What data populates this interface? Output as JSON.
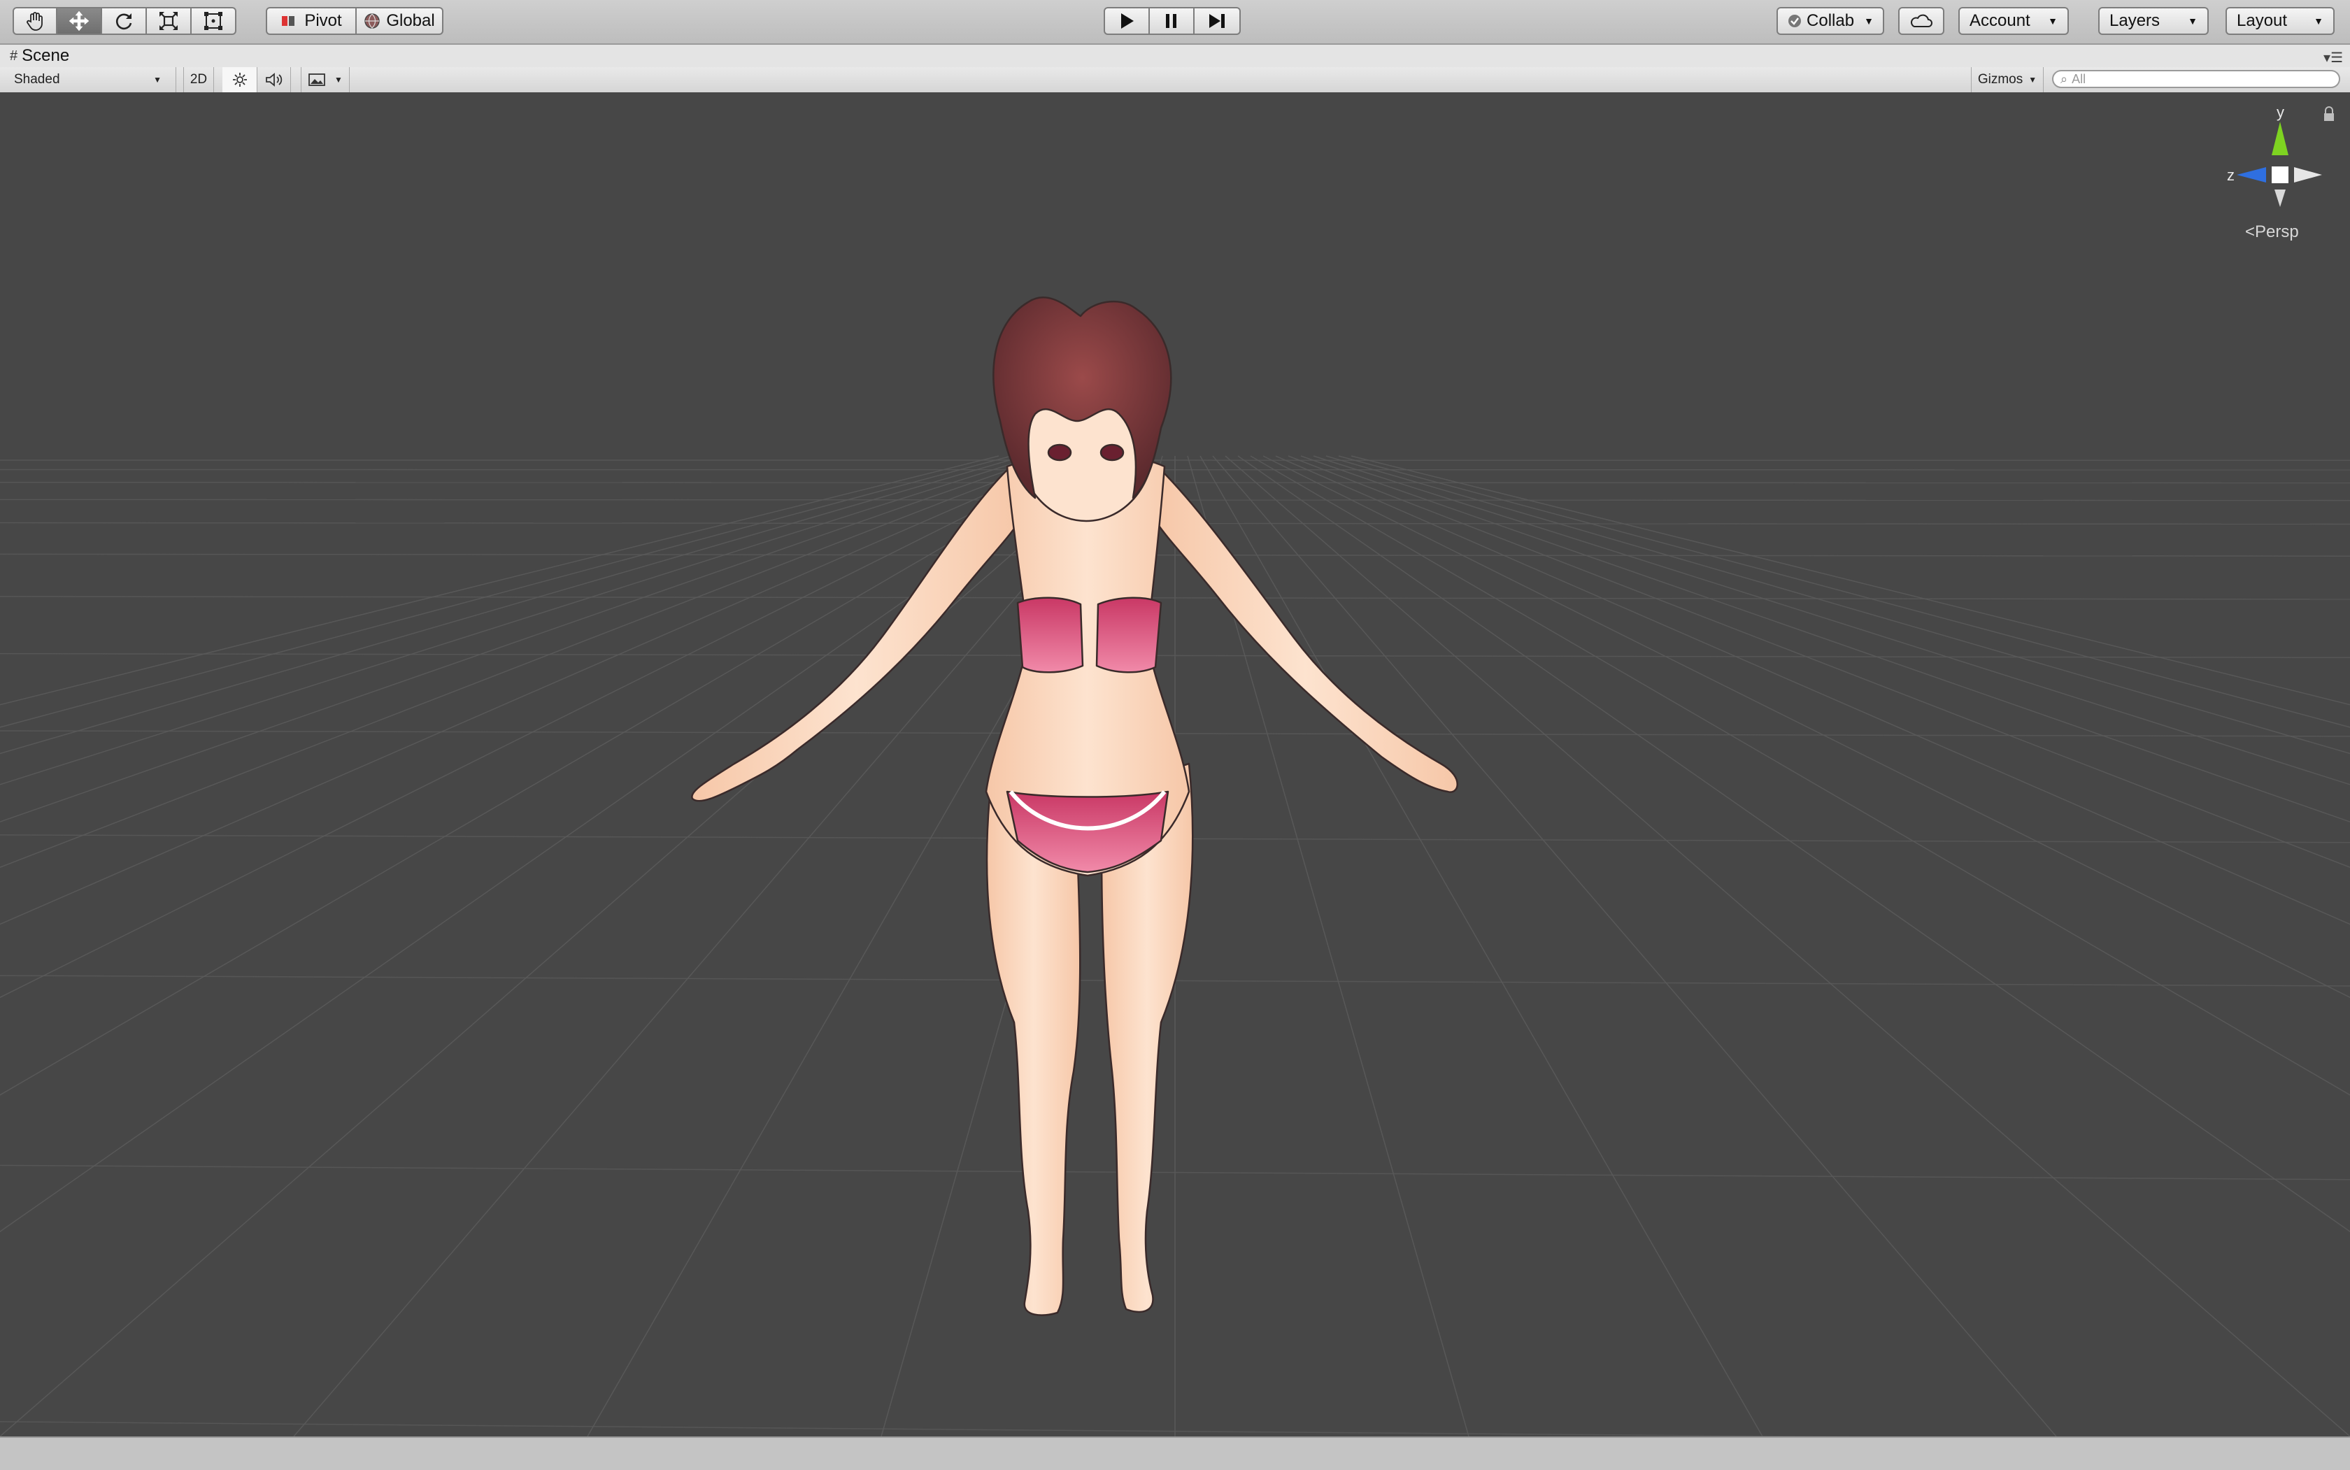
{
  "toolbar": {
    "transform_tools": [
      "hand-tool",
      "move-tool",
      "rotate-tool",
      "scale-tool",
      "rect-tool"
    ],
    "active_tool": "move-tool",
    "pivot_label": "Pivot",
    "global_label": "Global",
    "collab_label": "Collab",
    "account_label": "Account",
    "layers_label": "Layers",
    "layout_label": "Layout"
  },
  "scene_tab": {
    "title": "Scene"
  },
  "scene_toolbar": {
    "shading_mode": "Shaded",
    "mode_2d_label": "2D",
    "gizmos_label": "Gizmos",
    "search_placeholder": "All"
  },
  "orientation_gizmo": {
    "y_label": "y",
    "z_label": "z",
    "projection_label": "Persp"
  },
  "colors": {
    "viewport_bg": "#474747",
    "axis_y": "#7ed321",
    "axis_z": "#2f6fe0",
    "outfit_pink": "#d64b7a",
    "skin": "#fbd9c2",
    "hair": "#7a3a3a"
  }
}
